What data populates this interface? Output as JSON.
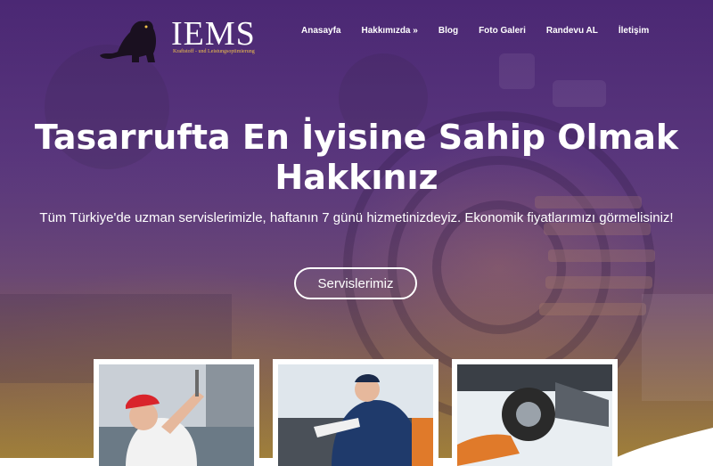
{
  "logo": {
    "brand": "IEMS",
    "tagline": "Kraftstoff - und Leistungsoptimierung",
    "icon": "panther-icon"
  },
  "nav": {
    "items": [
      "Anasayfa",
      "Hakkımızda »",
      "Blog",
      "Foto Galeri",
      "Randevu AL",
      "İletişim"
    ]
  },
  "hero": {
    "title_line1": "Tasarrufta En İyisine Sahip Olmak",
    "title_line2": "Hakkınız",
    "subtitle": "Tüm Türkiye'de uzman servislerimizle, haftanın 7 günü hizmetinizdeyiz. Ekonomik fiyatlarımızı görmelisiniz!",
    "cta_label": "Servislerimiz"
  },
  "cards": [
    {
      "image": "female-mechanic-photo"
    },
    {
      "image": "mechanic-engine-photo"
    },
    {
      "image": "wheel-repair-photo"
    }
  ],
  "colors": {
    "overlay_top": "#4e2d72",
    "overlay_bottom": "#a08240",
    "logo_sub": "#f2c24b"
  }
}
